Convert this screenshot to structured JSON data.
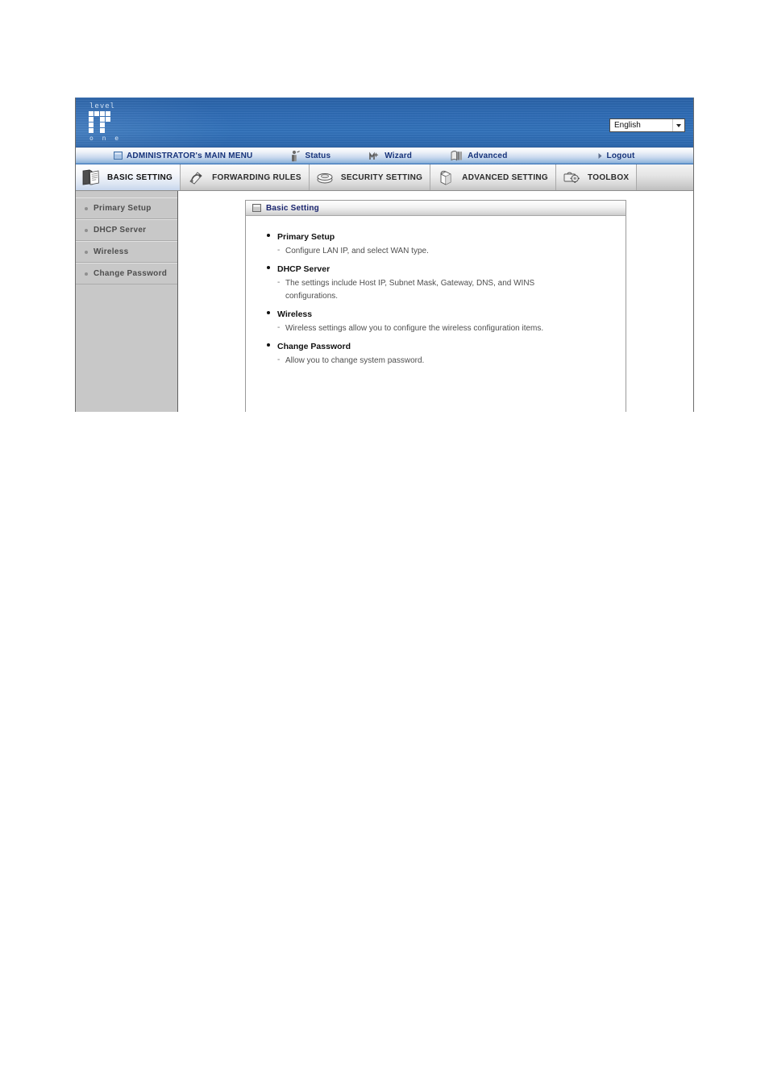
{
  "header": {
    "logo": {
      "top_text": "level",
      "bottom_text": "o n e",
      "name": "LevelOne"
    },
    "language_selector": {
      "value": "English",
      "arrow_icon": "chevron-down-icon"
    }
  },
  "admin_bar": {
    "items": [
      {
        "label": "ADMINISTRATOR's MAIN MENU",
        "icon": "window-icon"
      },
      {
        "label": "Status",
        "icon": "status-person-icon"
      },
      {
        "label": "Wizard",
        "icon": "wizard-wand-icon"
      },
      {
        "label": "Advanced",
        "icon": "advanced-book-icon"
      },
      {
        "label": "Logout",
        "icon": "arrow-right-icon"
      }
    ]
  },
  "tabs": [
    {
      "label": "BASIC SETTING",
      "icon": "book-notes-icon",
      "active": true
    },
    {
      "label": "FORWARDING RULES",
      "icon": "arrow-loop-icon",
      "active": false
    },
    {
      "label": "SECURITY SETTING",
      "icon": "shield-disc-icon",
      "active": false
    },
    {
      "label": "ADVANCED SETTING",
      "icon": "cube-icon",
      "active": false
    },
    {
      "label": "TOOLBOX",
      "icon": "toolbox-gear-icon",
      "active": false
    }
  ],
  "sidebar": {
    "items": [
      {
        "label": "Primary Setup"
      },
      {
        "label": "DHCP Server"
      },
      {
        "label": "Wireless"
      },
      {
        "label": "Change Password"
      }
    ]
  },
  "panel": {
    "title": "Basic Setting",
    "title_icon": "window-icon",
    "sections": [
      {
        "heading": "Primary Setup",
        "description": "Configure LAN IP, and select WAN type."
      },
      {
        "heading": "DHCP Server",
        "description": "The settings include Host IP, Subnet Mask, Gateway, DNS, and WINS configurations."
      },
      {
        "heading": "Wireless",
        "description": "Wireless settings allow you to configure the wireless configuration items."
      },
      {
        "heading": "Change Password",
        "description": "Allow you to change system password."
      }
    ]
  },
  "colors": {
    "header_blue": "#2f6cb5",
    "accent_dark_blue": "#16337a",
    "panel_title_blue": "#19246e",
    "sidebar_gray": "#c8c8c8"
  }
}
